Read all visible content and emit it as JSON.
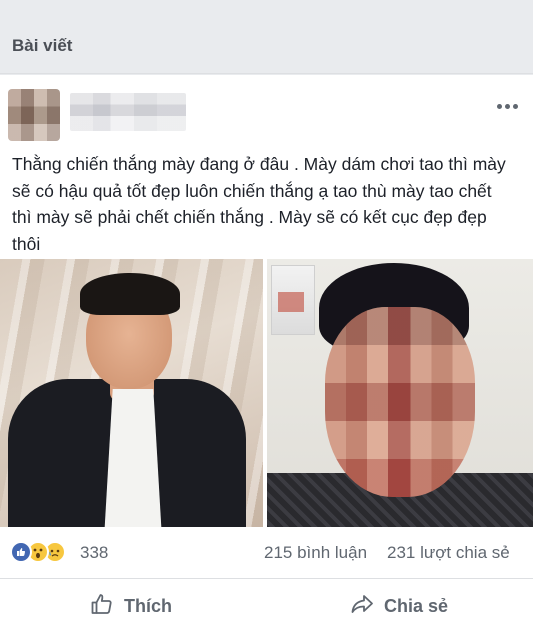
{
  "header": {
    "title": "Bài viết"
  },
  "post": {
    "text": "Thằng chiến thắng mày đang ở đâu . Mày dám chơi tao thì mày sẽ có hậu quả tốt đẹp luôn chiến thắng ạ tao thù mày tao chết thì mày sẽ phải chết chiến thắng . Mày sẽ có kết cục đẹp đẹp thôi"
  },
  "stats": {
    "reactions": "338",
    "comments": "215 bình luận",
    "shares": "231 lượt chia sẻ"
  },
  "actions": {
    "like_label": "Thích",
    "share_label": "Chia sẻ"
  },
  "icons": {
    "like": "thumbs-up-icon",
    "wow": "wow-emoji-icon",
    "sad": "sad-emoji-icon",
    "more": "more-dots-icon",
    "share": "share-arrow-icon"
  },
  "colors": {
    "facebook_blue": "#4267b2",
    "text_primary": "#1d2129",
    "text_secondary": "#606770",
    "header_bg": "#e9ebee"
  }
}
